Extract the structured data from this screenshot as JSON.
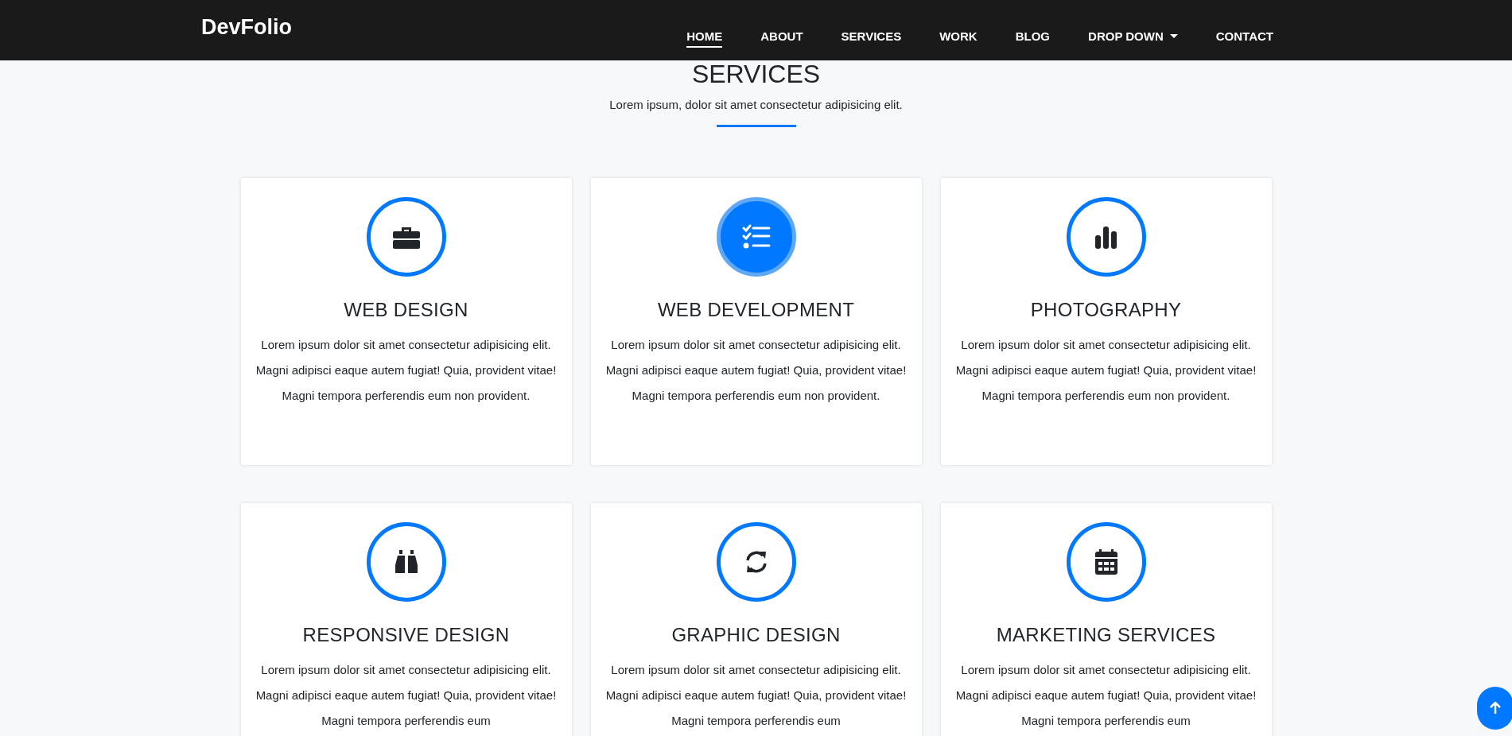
{
  "navbar": {
    "brand": "DevFolio",
    "items": [
      {
        "label": "HOME",
        "kind": "link",
        "selected": true
      },
      {
        "label": "ABOUT",
        "kind": "link",
        "selected": false
      },
      {
        "label": "SERVICES",
        "kind": "link",
        "selected": false
      },
      {
        "label": "WORK",
        "kind": "link",
        "selected": false
      },
      {
        "label": "BLOG",
        "kind": "link",
        "selected": false
      },
      {
        "label": "DROP DOWN",
        "kind": "dropdown",
        "selected": false
      },
      {
        "label": "CONTACT",
        "kind": "link",
        "selected": false
      }
    ]
  },
  "section": {
    "title": "SERVICES",
    "subtitle": "Lorem ipsum, dolor sit amet consectetur adipisicing elit."
  },
  "services": [
    {
      "title": "WEB DESIGN",
      "description": "Lorem ipsum dolor sit amet consectetur adipisicing elit. Magni adipisci eaque autem fugiat! Quia, provident vitae! Magni tempora perferendis eum non provident.",
      "highlighted": false
    },
    {
      "title": "WEB DEVELOPMENT",
      "description": "Lorem ipsum dolor sit amet consectetur adipisicing elit. Magni adipisci eaque autem fugiat! Quia, provident vitae! Magni tempora perferendis eum non provident.",
      "highlighted": true
    },
    {
      "title": "PHOTOGRAPHY",
      "description": "Lorem ipsum dolor sit amet consectetur adipisicing elit. Magni adipisci eaque autem fugiat! Quia, provident vitae! Magni tempora perferendis eum non provident.",
      "highlighted": false
    },
    {
      "title": "RESPONSIVE DESIGN",
      "description": "Lorem ipsum dolor sit amet consectetur adipisicing elit. Magni adipisci eaque autem fugiat! Quia, provident vitae! Magni tempora perferendis eum",
      "highlighted": false
    },
    {
      "title": "GRAPHIC DESIGN",
      "description": "Lorem ipsum dolor sit amet consectetur adipisicing elit. Magni adipisci eaque autem fugiat! Quia, provident vitae! Magni tempora perferendis eum",
      "highlighted": false
    },
    {
      "title": "MARKETING SERVICES",
      "description": "Lorem ipsum dolor sit amet consectetur adipisicing elit. Magni adipisci eaque autem fugiat! Quia, provident vitae! Magni tempora perferendis eum",
      "highlighted": false
    }
  ]
}
